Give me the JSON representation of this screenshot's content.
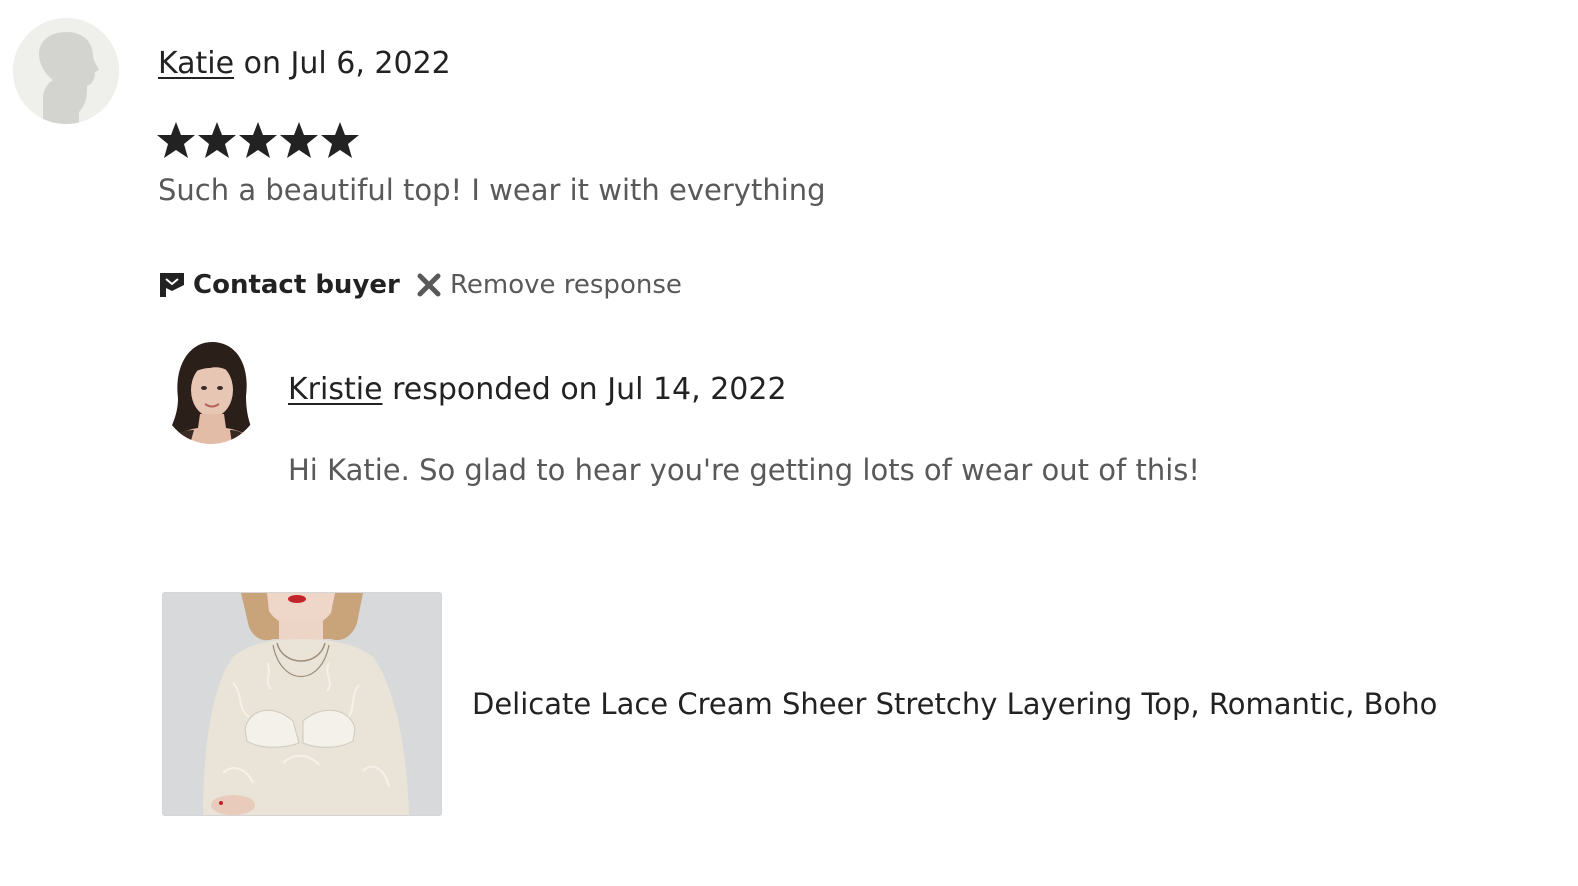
{
  "review": {
    "reviewer_name": "Katie",
    "date_text": " on Jul 6, 2022",
    "rating": 5,
    "rating_max": 5,
    "text": "Such a beautiful top! I wear it with everything"
  },
  "actions": {
    "contact_buyer_label": "Contact buyer",
    "contact_buyer_icon": "message-flag-icon",
    "remove_response_label": "Remove response",
    "remove_response_icon": "close-x-icon"
  },
  "response": {
    "seller_name": "Kristie",
    "date_text": " responded on Jul 14, 2022",
    "text": "Hi Katie. So glad to hear you're getting lots of wear out of this!"
  },
  "listing": {
    "title": "Delicate Lace Cream Sheer Stretchy Layering Top, Romantic, Boho"
  },
  "colors": {
    "primary_text": "#222222",
    "secondary_text": "#595959",
    "star": "#222222",
    "avatar_placeholder_bg": "#efefec"
  }
}
